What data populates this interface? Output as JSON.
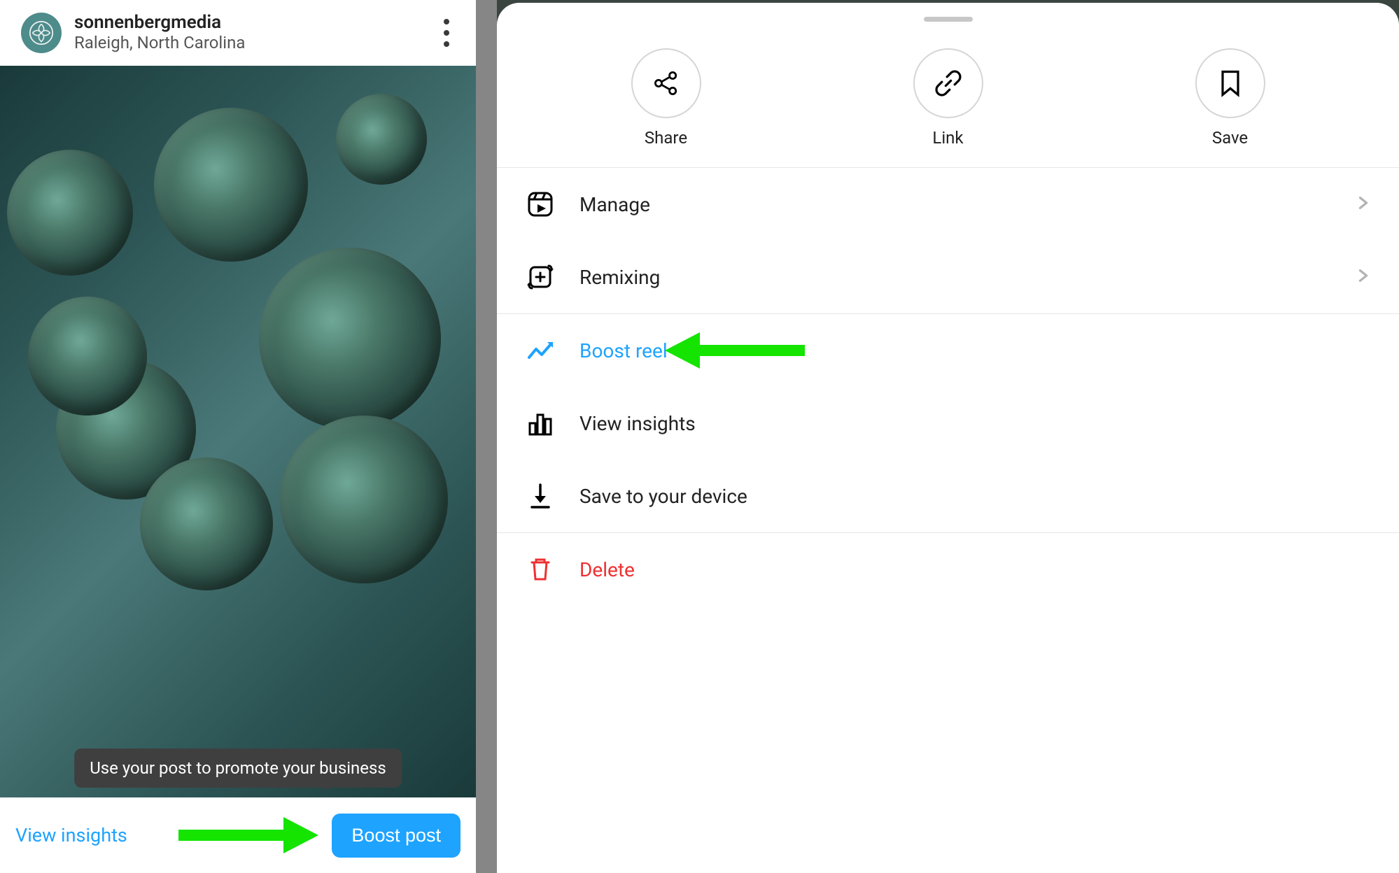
{
  "post": {
    "username": "sonnenbergmedia",
    "location": "Raleigh, North Carolina",
    "tooltip": "Use your post to promote your business",
    "view_insights": "View insights",
    "boost_post": "Boost post"
  },
  "sheet": {
    "actions": {
      "share": "Share",
      "link": "Link",
      "save": "Save"
    },
    "menu": {
      "manage": "Manage",
      "remixing": "Remixing",
      "boost_reel": "Boost reel",
      "view_insights": "View insights",
      "save_device": "Save to your device",
      "delete": "Delete"
    }
  },
  "colors": {
    "accent": "#1ea3ff",
    "danger": "#ee3031",
    "annotation": "#14e400"
  }
}
